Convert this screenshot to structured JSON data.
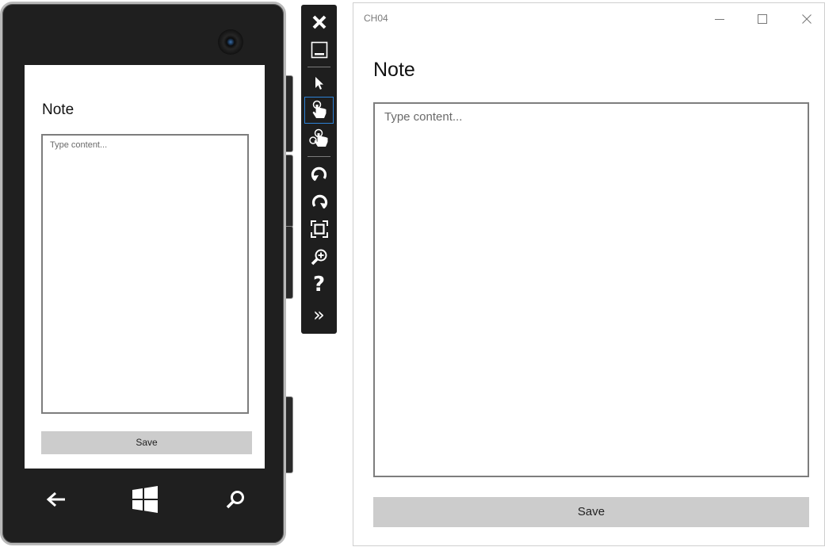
{
  "phone": {
    "page_title": "Note",
    "content_placeholder": "Type content...",
    "save_label": "Save",
    "nav": {
      "back_icon": "back-arrow-icon",
      "start_icon": "windows-logo-icon",
      "search_icon": "search-icon"
    }
  },
  "toolbar": {
    "items": [
      {
        "icon": "close-icon"
      },
      {
        "icon": "minimize-icon"
      },
      {
        "icon": "pointer-icon"
      },
      {
        "icon": "single-touch-icon",
        "active": true
      },
      {
        "icon": "multi-touch-icon"
      },
      {
        "icon": "rotate-left-icon"
      },
      {
        "icon": "rotate-right-icon"
      },
      {
        "icon": "fit-to-screen-icon"
      },
      {
        "icon": "zoom-icon"
      },
      {
        "icon": "help-icon",
        "glyph": "?"
      },
      {
        "icon": "expand-tools-icon",
        "glyph": "»"
      }
    ]
  },
  "window": {
    "title": "CH04",
    "heading": "Note",
    "content_placeholder": "Type content...",
    "save_label": "Save"
  },
  "colors": {
    "phone_body": "#1f1f1f",
    "button_gray": "#cccccc",
    "active_blue": "#2d82d6"
  }
}
